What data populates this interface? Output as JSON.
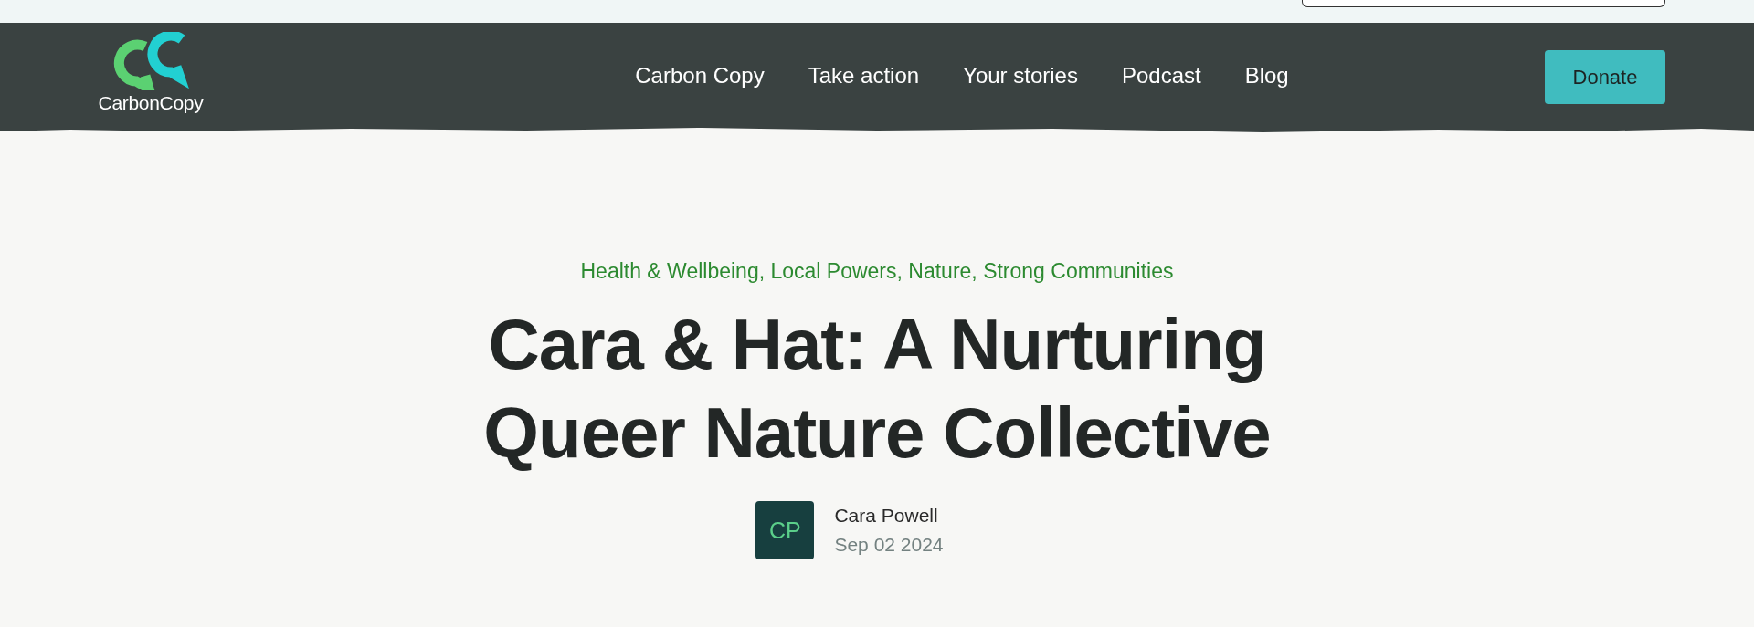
{
  "logo": {
    "text": "CarbonCopy"
  },
  "nav": {
    "items": [
      {
        "label": "Carbon Copy"
      },
      {
        "label": "Take action"
      },
      {
        "label": "Your stories"
      },
      {
        "label": "Podcast"
      },
      {
        "label": "Blog"
      }
    ],
    "button": "Donate"
  },
  "article": {
    "categories": "Health & Wellbeing, Local Powers, Nature, Strong Communities",
    "title_lines": [
      "Cara & Hat: A Nurturing",
      "Queer Nature Collective"
    ],
    "author": {
      "initials": "CP",
      "name": "Cara Powell",
      "date": "Sep 02 2024"
    }
  }
}
